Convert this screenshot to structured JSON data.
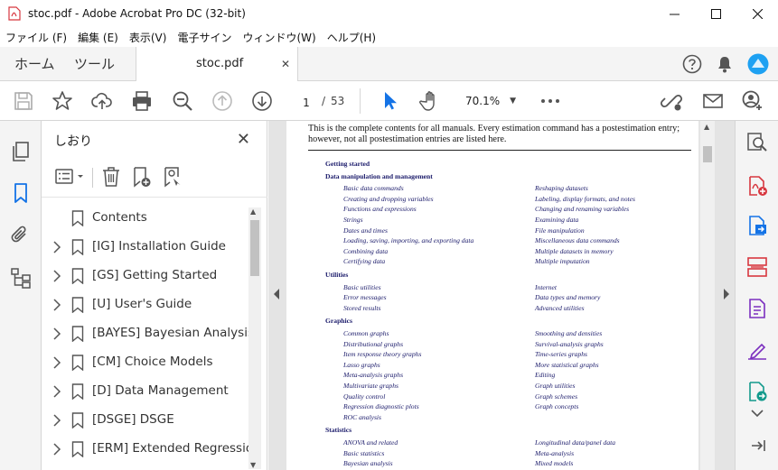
{
  "window": {
    "title": "stoc.pdf - Adobe Acrobat Pro DC (32-bit)"
  },
  "menu": [
    "ファイル (F)",
    "編集 (E)",
    "表示(V)",
    "電子サイン",
    "ウィンドウ(W)",
    "ヘルプ(H)"
  ],
  "tabs": {
    "home": "ホーム",
    "tools": "ツール",
    "document": "stoc.pdf",
    "close_glyph": "✕"
  },
  "toolbar": {
    "page_current": "1",
    "page_separator": "/",
    "page_total": "53",
    "zoom": "70.1%"
  },
  "bookmarks": {
    "title": "しおり",
    "close_glyph": "✕",
    "items": [
      {
        "label": "Contents",
        "expandable": false
      },
      {
        "label": "[IG] Installation Guide",
        "expandable": true
      },
      {
        "label": "[GS] Getting Started",
        "expandable": true
      },
      {
        "label": "[U] User's Guide",
        "expandable": true
      },
      {
        "label": "[BAYES] Bayesian Analysis",
        "expandable": true
      },
      {
        "label": "[CM] Choice Models",
        "expandable": true
      },
      {
        "label": "[D] Data Management",
        "expandable": true
      },
      {
        "label": "[DSGE] DSGE",
        "expandable": true
      },
      {
        "label": "[ERM] Extended Regression",
        "expandable": true
      }
    ]
  },
  "document": {
    "intro": "This is the complete contents for all manuals. Every estimation command has a postestimation entry; however, not all postestimation entries are listed here.",
    "toc": {
      "getting_started": "Getting started",
      "data_mgmt": "Data manipulation and management",
      "data_left": [
        "Basic data commands",
        "Creating and dropping variables",
        "Functions and expressions",
        "Strings",
        "Dates and times",
        "Loading, saving, importing, and exporting data",
        "Combining data",
        "Certifying data"
      ],
      "data_right": [
        "Reshaping datasets",
        "Labeling, display formats, and notes",
        "Changing and renaming variables",
        "Examining data",
        "File manipulation",
        "Miscellaneous data commands",
        "Multiple datasets in memory",
        "Multiple imputation"
      ],
      "utilities": "Utilities",
      "util_left": [
        "Basic utilities",
        "Error messages",
        "Stored results"
      ],
      "util_right": [
        "Internet",
        "Data types and memory",
        "Advanced utilities"
      ],
      "graphics": "Graphics",
      "graph_left": [
        "Common graphs",
        "Distributional graphs",
        "Item response theory graphs",
        "Lasso graphs",
        "Meta-analysis graphs",
        "Multivariate graphs",
        "Quality control",
        "Regression diagnostic plots",
        "ROC analysis"
      ],
      "graph_right": [
        "Smoothing and densities",
        "Survival-analysis graphs",
        "Time-series graphs",
        "More statistical graphs",
        "Editing",
        "Graph utilities",
        "Graph schemes",
        "Graph concepts"
      ],
      "statistics": "Statistics",
      "stat_left": [
        "ANOVA and related",
        "Basic statistics",
        "Bayesian analysis"
      ],
      "stat_right": [
        "Longitudinal data/panel data",
        "Meta-analysis",
        "Mixed models"
      ]
    }
  },
  "colors": {
    "accent_blue": "#1473e6",
    "toc_link": "#1a1a6a",
    "acrobat_red": "#d7373f",
    "tool_purple": "#7b2fbf"
  }
}
